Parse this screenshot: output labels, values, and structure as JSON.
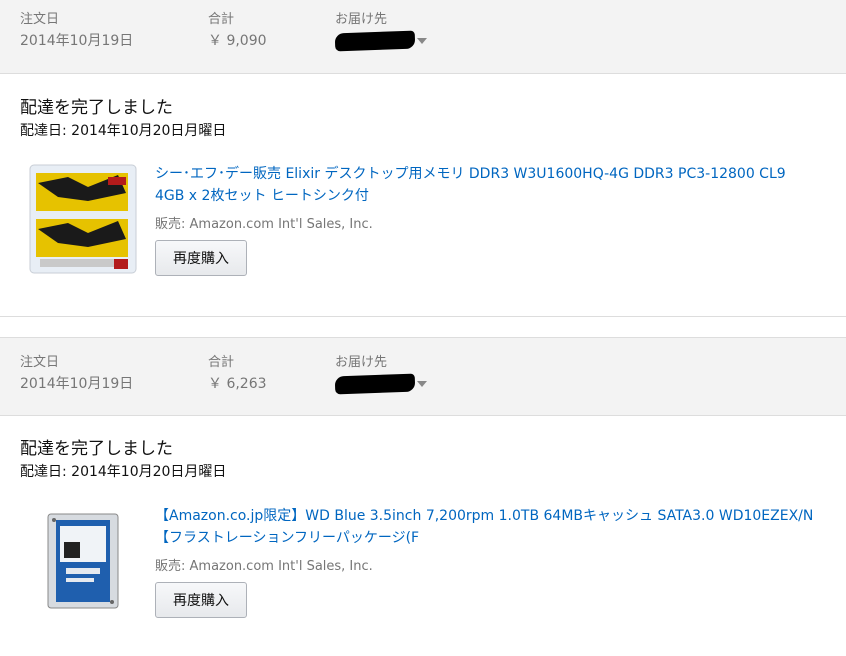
{
  "orders": [
    {
      "header": {
        "date_label": "注文日",
        "date_value": "2014年10月19日",
        "total_label": "合計",
        "total_value": "￥ 9,090",
        "ship_label": "お届け先"
      },
      "status": "配達を完了しました",
      "delivery": "配達日: 2014年10月20日月曜日",
      "item": {
        "title_line1": "シー･エフ･デー販売 Elixir デスクトップ用メモリ DDR3 W3U1600HQ-4G DDR3 PC3-12800 CL9",
        "title_line2": "4GB x 2枚セット ヒートシンク付",
        "seller": "販売: Amazon.com Int'l Sales, Inc.",
        "button": "再度購入"
      }
    },
    {
      "header": {
        "date_label": "注文日",
        "date_value": "2014年10月19日",
        "total_label": "合計",
        "total_value": "￥ 6,263",
        "ship_label": "お届け先"
      },
      "status": "配達を完了しました",
      "delivery": "配達日: 2014年10月20日月曜日",
      "item": {
        "title_line1": "【Amazon.co.jp限定】WD Blue 3.5inch 7,200rpm 1.0TB 64MBキャッシュ SATA3.0 WD10EZEX/N",
        "title_line2": "【フラストレーションフリーパッケージ(F",
        "seller": "販売: Amazon.com Int'l Sales, Inc.",
        "button": "再度購入"
      }
    }
  ],
  "icons": {
    "ram_image": "ddr3-memory-product-image",
    "hdd_image": "hard-drive-product-image",
    "caret": "chevron-down-icon"
  },
  "colors": {
    "link": "#0066c0",
    "muted": "#767676",
    "header_bg": "#f3f3f3"
  }
}
